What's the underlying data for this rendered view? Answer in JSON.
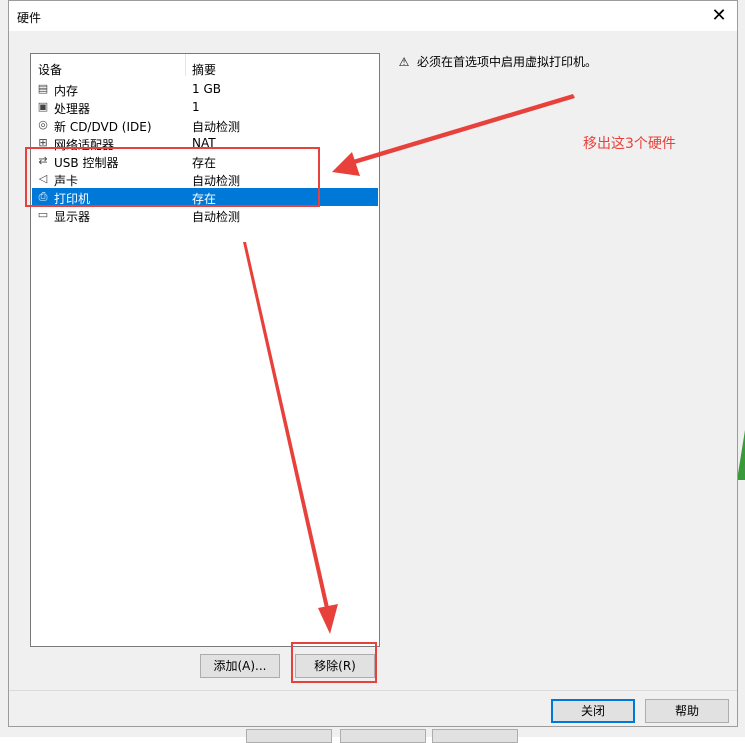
{
  "window": {
    "title": "硬件",
    "close_glyph": "✕"
  },
  "device_list": {
    "headers": {
      "device": "设备",
      "summary": "摘要"
    },
    "rows": [
      {
        "name": "内存",
        "summary": "1 GB",
        "icon": "memory-icon",
        "glyph": "▤"
      },
      {
        "name": "处理器",
        "summary": "1",
        "icon": "cpu-icon",
        "glyph": "▣"
      },
      {
        "name": "新 CD/DVD (IDE)",
        "summary": "自动检测",
        "icon": "cd-dvd-icon",
        "glyph": "◎"
      },
      {
        "name": "网络适配器",
        "summary": "NAT",
        "icon": "network-adapter-icon",
        "glyph": "⊞"
      },
      {
        "name": "USB 控制器",
        "summary": "存在",
        "icon": "usb-icon",
        "glyph": "⇄"
      },
      {
        "name": "声卡",
        "summary": "自动检测",
        "icon": "speaker-icon",
        "glyph": "◁"
      },
      {
        "name": "打印机",
        "summary": "存在",
        "icon": "printer-icon",
        "glyph": "⎙",
        "selected": true
      },
      {
        "name": "显示器",
        "summary": "自动检测",
        "icon": "display-icon",
        "glyph": "▭"
      }
    ]
  },
  "buttons": {
    "add": "添加(A)...",
    "remove": "移除(R)",
    "close": "关闭",
    "help": "帮助"
  },
  "notice": {
    "icon": "warning-icon",
    "glyph": "⚠",
    "text": "必须在首选项中启用虚拟打印机。"
  },
  "annotation": {
    "text": "移出这3个硬件",
    "color": "#e8413b"
  },
  "colors": {
    "selection": "#0078d7",
    "accent": "#0078d7",
    "annotation_red": "#e8413b"
  }
}
